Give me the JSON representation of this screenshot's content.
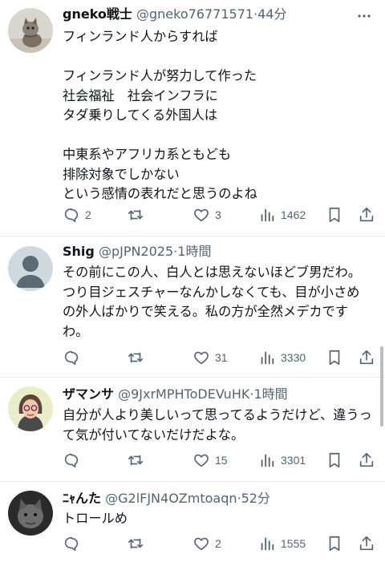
{
  "posts": [
    {
      "name": "gneko戦士",
      "handle": "@gneko76771571",
      "time": "44分",
      "text": "フィンランド人からすれば\n\nフィンランド人が努力して作った\n社会福祉　社会インフラに\nタダ乗りしてくる外国人は\n\n中東系やアフリカ系ともども\n排除対象でしかない\nという感情の表れだと思うのよね",
      "replies": "2",
      "retweets": "",
      "likes": "3",
      "views": "1462"
    },
    {
      "name": "Shig",
      "handle": "@pJPN2025",
      "time": "1時間",
      "text": "その前にこの人、白人とは思えないほどブ男だわ。つり目ジェスチャーなんかしなくても、目が小さめの外人ばかりで笑える。私の方が全然メデカですわ。",
      "replies": "",
      "retweets": "",
      "likes": "31",
      "views": "3330"
    },
    {
      "name": "ザマンサ",
      "handle": "@9JxrMPHToDEVuHK",
      "time": "1時間",
      "text": "自分が人より美しいって思ってるようだけど、違うって気が付いてないだけだよな。",
      "replies": "",
      "retweets": "",
      "likes": "15",
      "views": "3301"
    },
    {
      "name": "ﾆｬんた",
      "handle": "@G2lFJN4OZmtoaqn",
      "time": "52分",
      "text": "トロールめ",
      "replies": "",
      "retweets": "",
      "likes": "2",
      "views": "1555"
    }
  ],
  "separator": "·",
  "icons": {
    "more": "more-dots-icon",
    "reply": "reply-bubble-icon",
    "retweet": "retweet-icon",
    "like": "heart-icon",
    "views": "views-bars-icon",
    "bookmark": "bookmark-icon",
    "share": "share-icon"
  },
  "colors": {
    "text": "#0f1419",
    "secondary": "#536471",
    "divider": "#e6e9ec"
  }
}
